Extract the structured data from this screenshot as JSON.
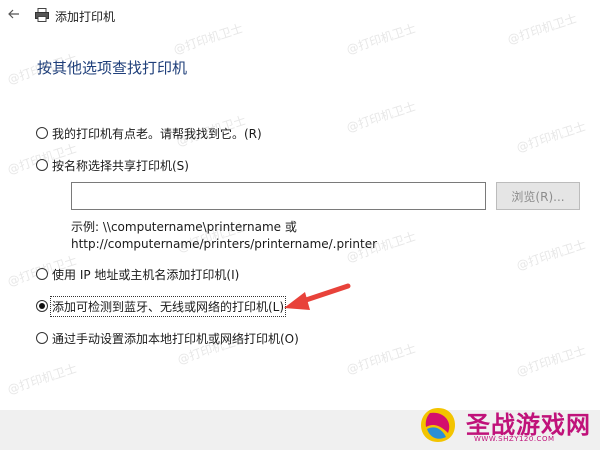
{
  "window": {
    "title": "添加打印机"
  },
  "heading": "按其他选项查找打印机",
  "options": [
    {
      "label": "我的打印机有点老。请帮我找到它。(R)",
      "checked": false
    },
    {
      "label": "按名称选择共享打印机(S)",
      "checked": false
    },
    {
      "label": "使用 IP 地址或主机名添加打印机(I)",
      "checked": false
    },
    {
      "label": "添加可检测到蓝牙、无线或网络的打印机(L)",
      "checked": true
    },
    {
      "label": "通过手动设置添加本地打印机或网络打印机(O)",
      "checked": false
    }
  ],
  "share_input": {
    "value": ""
  },
  "browse_button": {
    "label": "浏览(R)..."
  },
  "example": {
    "line1": "示例: \\\\computername\\printername 或",
    "line2": "http://computername/printers/printername/.printer"
  },
  "watermark": {
    "text": "@打印机卫士"
  },
  "logo": {
    "name": "圣战游戏网",
    "url": "WWW.SHZY120.COM"
  },
  "colors": {
    "heading": "#1f3f7a",
    "arrow": "#e8423a",
    "logo": "#c0127a"
  }
}
